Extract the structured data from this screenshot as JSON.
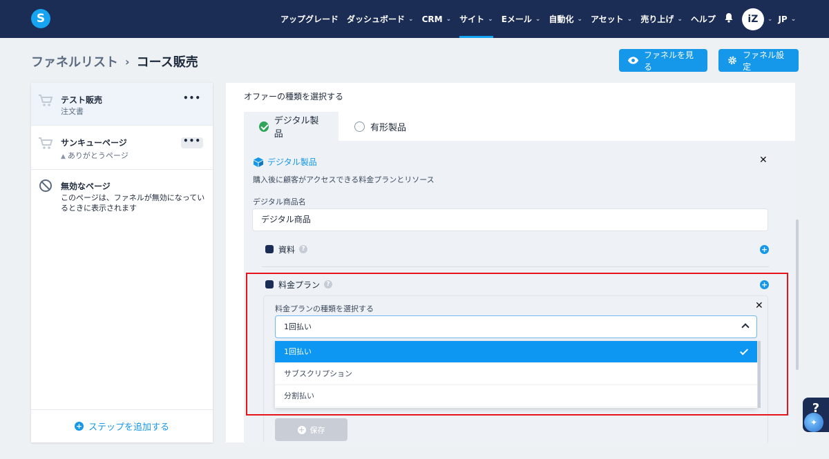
{
  "app": {
    "logo_letter": "S"
  },
  "nav": {
    "items": [
      {
        "label": "アップグレード",
        "chevron": false,
        "active": false
      },
      {
        "label": "ダッシュボード",
        "chevron": true,
        "active": false
      },
      {
        "label": "CRM",
        "chevron": true,
        "active": false
      },
      {
        "label": "サイト",
        "chevron": true,
        "active": true
      },
      {
        "label": "Eメール",
        "chevron": true,
        "active": false
      },
      {
        "label": "自動化",
        "chevron": true,
        "active": false
      },
      {
        "label": "アセット",
        "chevron": true,
        "active": false
      },
      {
        "label": "売り上げ",
        "chevron": true,
        "active": false
      },
      {
        "label": "ヘルプ",
        "chevron": false,
        "active": false
      }
    ],
    "avatar_text": "iZ",
    "language": "JP"
  },
  "header": {
    "breadcrumb_root": "ファネルリスト",
    "breadcrumb_current": "コース販売",
    "view_funnel_label": "ファネルを見る",
    "funnel_settings_label": "ファネル設定"
  },
  "steps": [
    {
      "title": "テスト販売",
      "subtitle": "注文書",
      "menu": "•••"
    },
    {
      "title": "サンキューページ",
      "subtitle": "ありがとうページ",
      "menu": "•••"
    },
    {
      "title": "無効なページ",
      "description": "このページは、ファネルが無効になっているときに表示されます"
    }
  ],
  "add_step_label": "ステップを追加する",
  "offer": {
    "select_label": "オファーの種類を選択する",
    "tab_digital": "デジタル製品",
    "tab_physical": "有形製品",
    "product_title": "デジタル製品",
    "product_desc": "購入後に顧客がアクセスできる料金プランとリソース",
    "name_label": "デジタル商品名",
    "name_value": "デジタル商品",
    "resources_label": "資料",
    "pricing_label": "料金プラン",
    "plan_type_label": "料金プランの種類を選択する",
    "plan_selected": "1回払い",
    "plan_options": [
      "1回払い",
      "サブスクリプション",
      "分割払い"
    ],
    "save_label": "保存"
  },
  "help_widget": {
    "label": "?"
  },
  "colors": {
    "navbar": "#1b2c55",
    "accent": "#1597ea",
    "highlight": "#e5131a",
    "success": "#2fa45a"
  }
}
